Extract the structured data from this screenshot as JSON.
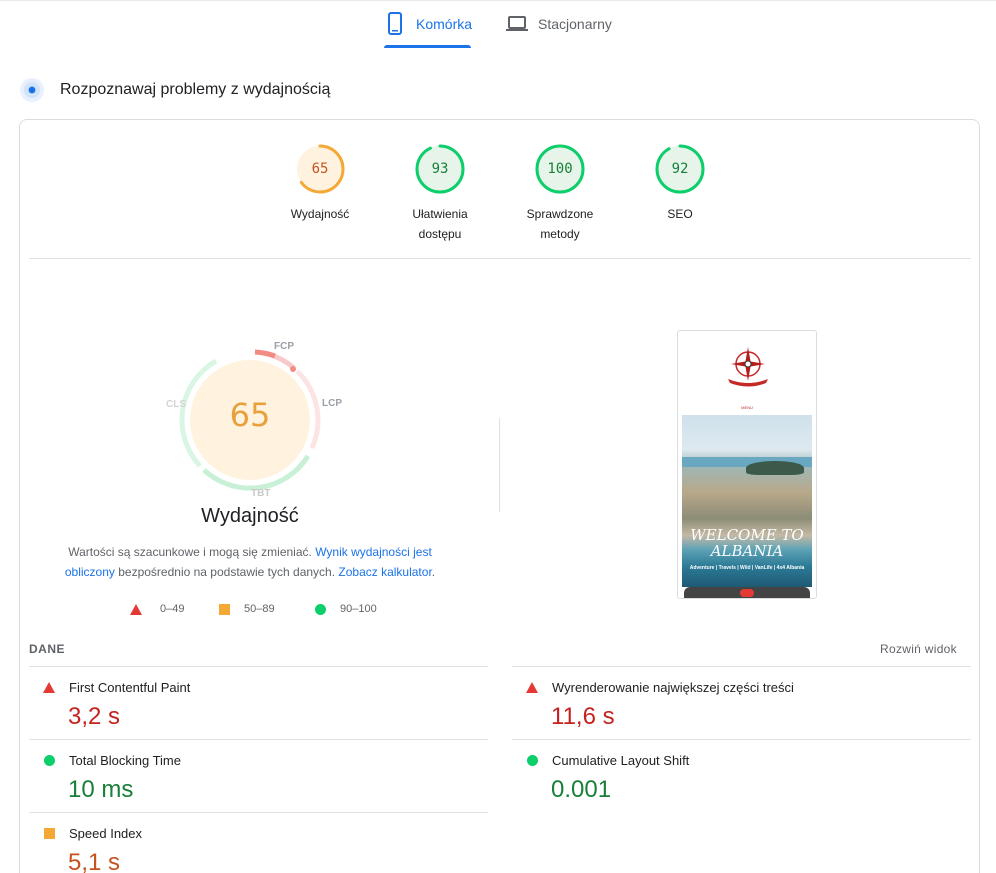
{
  "tabs": {
    "mobile": {
      "label": "Komórka",
      "icon": "smartphone-icon",
      "active": true
    },
    "desktop": {
      "label": "Stacjonarny",
      "icon": "laptop-icon",
      "active": false
    }
  },
  "section": {
    "title": "Rozpoznawaj problemy z wydajnością",
    "icon": "lab-data-icon"
  },
  "gauges": [
    {
      "score": "65",
      "label_line1": "Wydajność",
      "label_line2": "",
      "status": "average",
      "color": "#f4a937",
      "fill": 0.65
    },
    {
      "score": "93",
      "label_line1": "Ułatwienia",
      "label_line2": "dostępu",
      "status": "pass",
      "color": "#0cce6b",
      "fill": 0.93
    },
    {
      "score": "100",
      "label_line1": "Sprawdzone",
      "label_line2": "metody",
      "status": "pass",
      "color": "#0cce6b",
      "fill": 1.0
    },
    {
      "score": "92",
      "label_line1": "SEO",
      "label_line2": "",
      "status": "pass",
      "color": "#0cce6b",
      "fill": 0.92
    }
  ],
  "performance": {
    "score": "65",
    "title": "Wydajność",
    "metric_labels": {
      "fcp": "FCP",
      "lcp": "LCP",
      "tbt": "TBT",
      "cls": "CLS"
    },
    "note": {
      "part1": "Wartości są szacunkowe i mogą się zmieniać. ",
      "link1": "Wynik wydajności jest obliczony",
      "part2": " bezpośrednio na podstawie tych danych. ",
      "link2": "Zobacz kalkulator",
      "part3": "."
    },
    "legend": {
      "fail": "0–49",
      "average": "50–89",
      "pass": "90–100"
    }
  },
  "screenshot": {
    "menu_text": "MENU",
    "welcome": "Welcome to Albania",
    "welcome_line1": "WELCOME TO",
    "welcome_line2": "ALBANIA",
    "subtitle": "Adventure | Travels | Wild | VanLife | 4x4 Albania"
  },
  "data_section": {
    "title": "DANE",
    "expand_label": "Rozwiń widok"
  },
  "metrics": [
    {
      "name": "First Contentful Paint",
      "value": "3,2 s",
      "status": "fail"
    },
    {
      "name": "Wyrenderowanie największej części treści",
      "value": "11,6 s",
      "status": "fail"
    },
    {
      "name": "Total Blocking Time",
      "value": "10 ms",
      "status": "pass"
    },
    {
      "name": "Cumulative Layout Shift",
      "value": "0.001",
      "status": "pass"
    },
    {
      "name": "Speed Index",
      "value": "5,1 s",
      "status": "average"
    }
  ],
  "colors": {
    "accent": "#1a73e8",
    "fail": "#e53935",
    "average": "#f4a937",
    "pass": "#0cce6b"
  }
}
